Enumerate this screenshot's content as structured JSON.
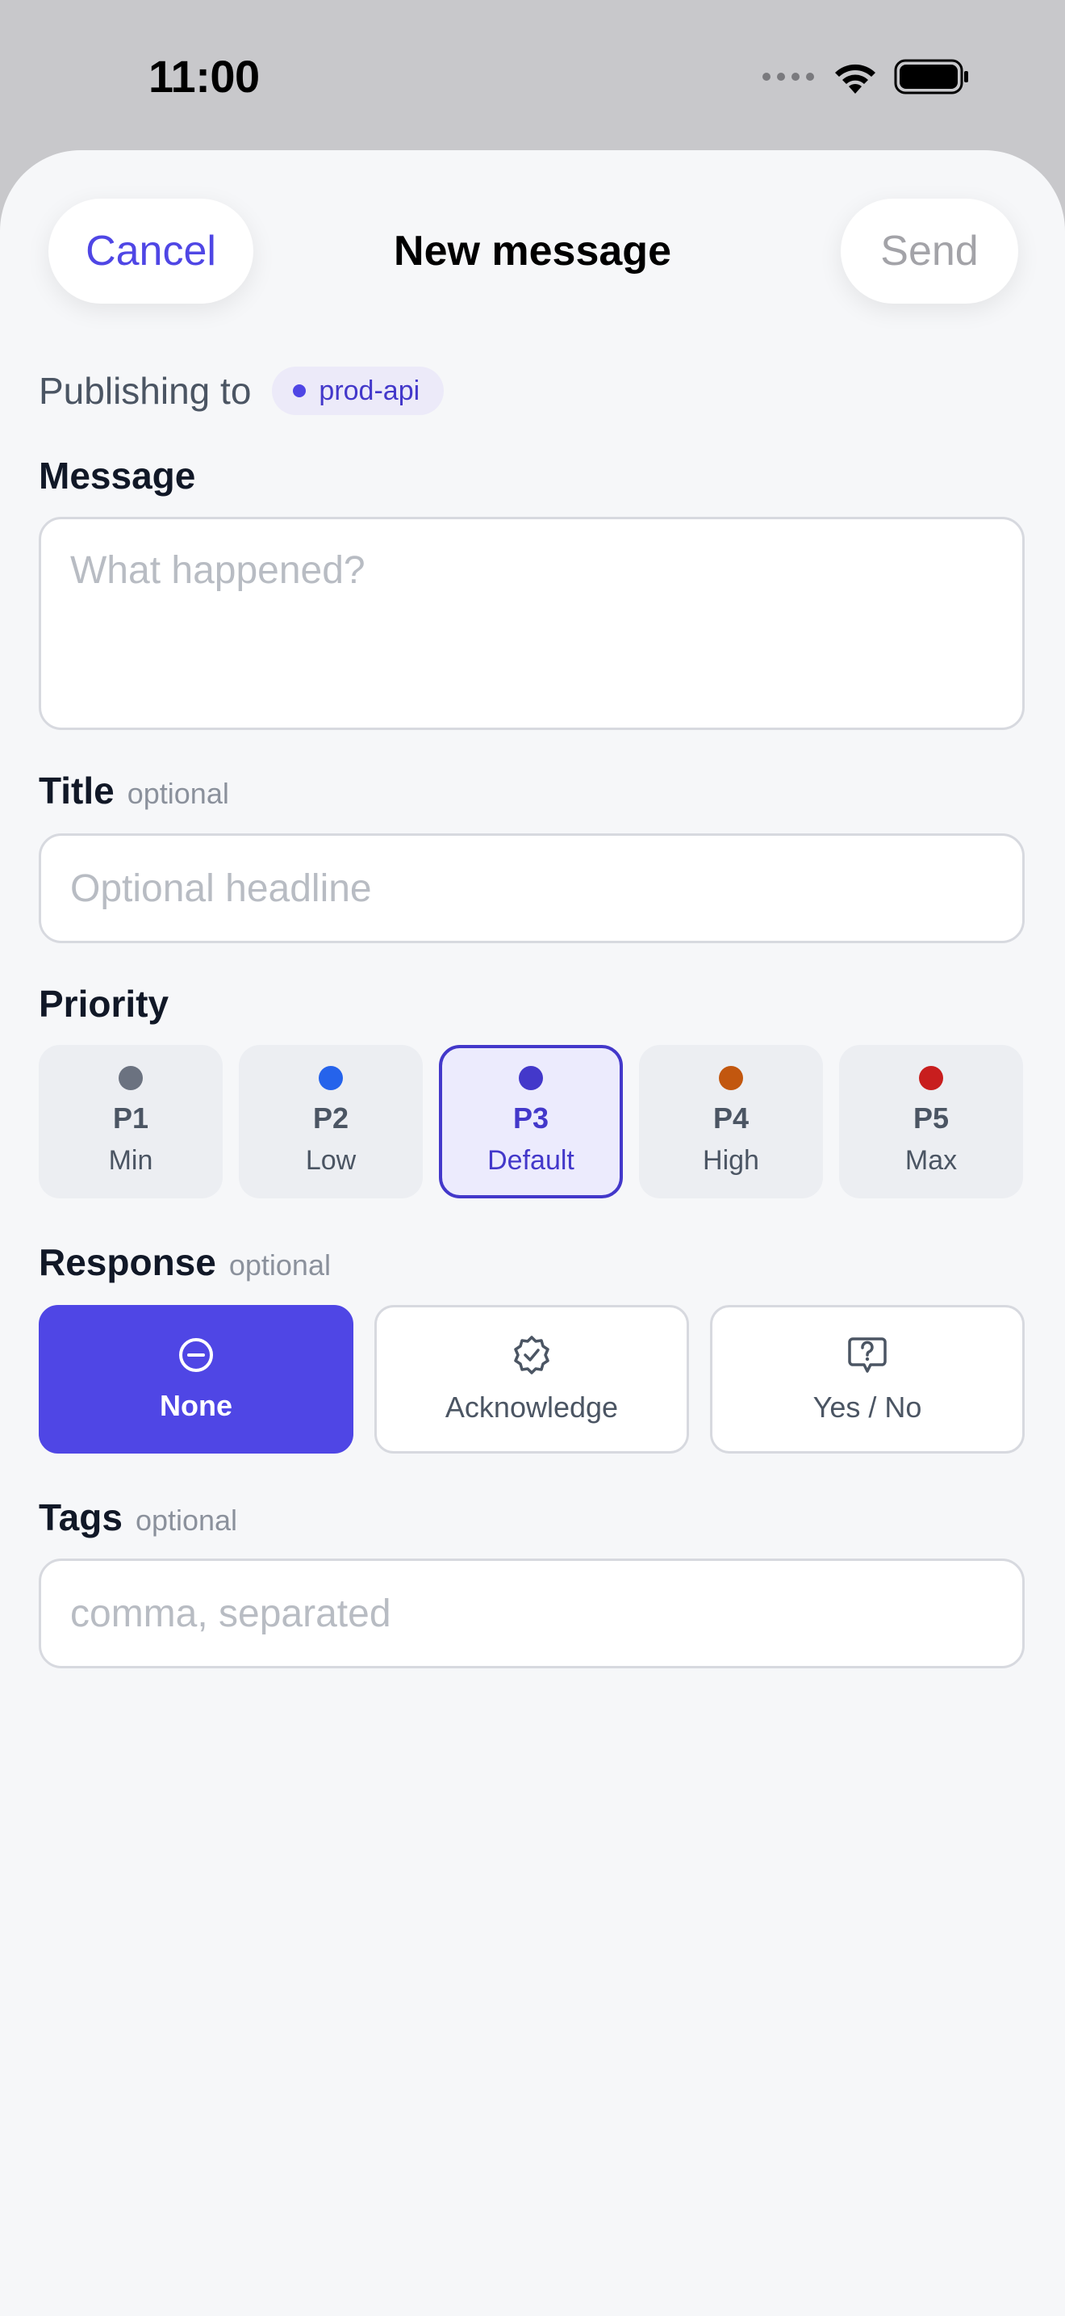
{
  "status_bar": {
    "time": "11:00"
  },
  "header": {
    "cancel_label": "Cancel",
    "title": "New message",
    "send_label": "Send"
  },
  "publishing": {
    "label": "Publishing to",
    "topic": "prod-api"
  },
  "message": {
    "label": "Message",
    "placeholder": "What happened?",
    "value": ""
  },
  "title_field": {
    "label": "Title",
    "optional": "optional",
    "placeholder": "Optional headline",
    "value": ""
  },
  "priority": {
    "label": "Priority",
    "selected": "P3",
    "options": [
      {
        "code": "P1",
        "name": "Min",
        "color": "#6b7280"
      },
      {
        "code": "P2",
        "name": "Low",
        "color": "#2563eb"
      },
      {
        "code": "P3",
        "name": "Default",
        "color": "#4338ca"
      },
      {
        "code": "P4",
        "name": "High",
        "color": "#c2570f"
      },
      {
        "code": "P5",
        "name": "Max",
        "color": "#c81e1e"
      }
    ]
  },
  "response": {
    "label": "Response",
    "optional": "optional",
    "selected": "None",
    "options": [
      {
        "label": "None",
        "icon": "minus-circle-icon"
      },
      {
        "label": "Acknowledge",
        "icon": "badge-check-icon"
      },
      {
        "label": "Yes / No",
        "icon": "message-question-icon"
      }
    ]
  },
  "tags": {
    "label": "Tags",
    "optional": "optional",
    "placeholder": "comma, separated",
    "value": ""
  },
  "colors": {
    "accent": "#4f46e5",
    "background": "#f6f7f9"
  }
}
